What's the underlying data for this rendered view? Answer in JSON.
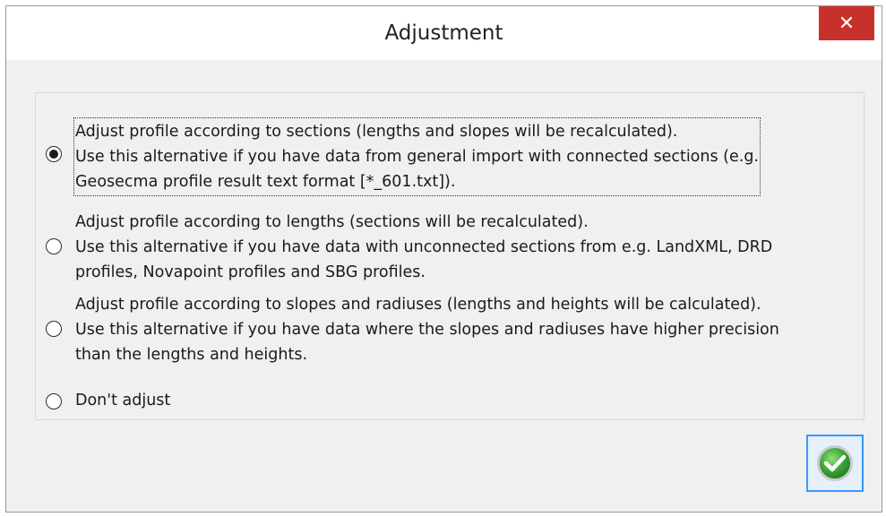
{
  "dialog": {
    "title": "Adjustment",
    "close_label": "✕"
  },
  "options": [
    {
      "id": "sections",
      "selected": true,
      "lines": [
        "Adjust profile according to sections (lengths and slopes will be recalculated).",
        "Use this alternative if you have data from general import with connected sections (e.g.",
        "Geosecma profile result text format [*_601.txt])."
      ]
    },
    {
      "id": "lengths",
      "selected": false,
      "lines": [
        "Adjust profile according to lengths (sections will be recalculated).",
        "Use this alternative if you have data with unconnected sections from e.g. LandXML, DRD",
        "profiles, Novapoint profiles and SBG profiles."
      ]
    },
    {
      "id": "slopes",
      "selected": false,
      "lines": [
        "Adjust profile according to slopes and radiuses (lengths and heights will be calculated).",
        "Use this alternative if you have data where the slopes and radiuses have higher precision",
        "than the lengths and heights."
      ]
    },
    {
      "id": "none",
      "selected": false,
      "lines": [
        "Don't adjust"
      ]
    }
  ],
  "colors": {
    "close_bg": "#c7302b",
    "ok_border": "#3399ff",
    "ok_green": "#3fae3a"
  },
  "icons": {
    "close": "close-icon",
    "ok": "checkmark-icon"
  }
}
